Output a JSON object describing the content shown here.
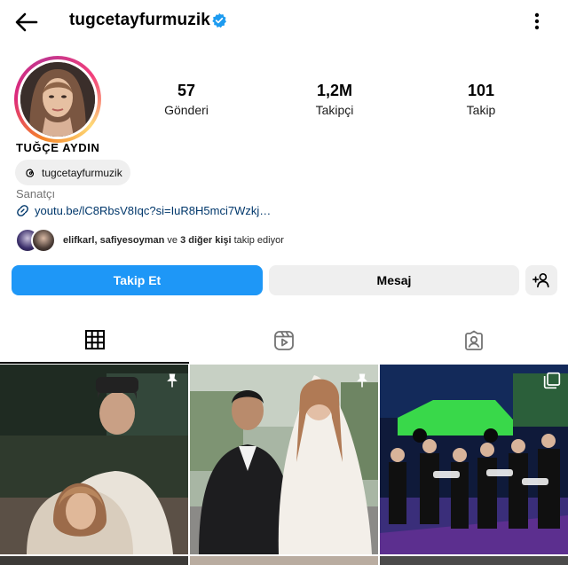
{
  "header": {
    "username": "tugcetayfurmuzik",
    "verified": true,
    "icons": {
      "back": "arrow-left-icon",
      "more": "more-vertical-icon",
      "verified": "verified-badge-icon"
    }
  },
  "profile": {
    "full_name": "TUĞÇE AYDIN",
    "threads_handle": "tugcetayfurmuzik",
    "category": "Sanatçı",
    "link": "youtu.be/lC8RbsV8Iqc?si=IuR8H5mci7Wzkj…",
    "followed_by": {
      "names": "elifkarl, safiyesoyman",
      "middle": " ve ",
      "others": "3 diğer kişi",
      "suffix": " takip ediyor"
    }
  },
  "stats": [
    {
      "value": "57",
      "label": "Gönderi"
    },
    {
      "value": "1,2M",
      "label": "Takipçi"
    },
    {
      "value": "101",
      "label": "Takip"
    }
  ],
  "actions": {
    "follow": "Takip Et",
    "message": "Mesaj",
    "add_user_icon": "person-add-icon"
  },
  "tabs": [
    {
      "name": "posts",
      "icon": "grid-icon",
      "active": true
    },
    {
      "name": "reels",
      "icon": "reels-icon",
      "active": false
    },
    {
      "name": "tagged",
      "icon": "tagged-person-icon",
      "active": false
    }
  ],
  "colors": {
    "follow_button": "#1e97f7",
    "secondary_button": "#efefef",
    "verified": "#1d9bf0",
    "link": "#00376b",
    "muted": "#737373"
  }
}
